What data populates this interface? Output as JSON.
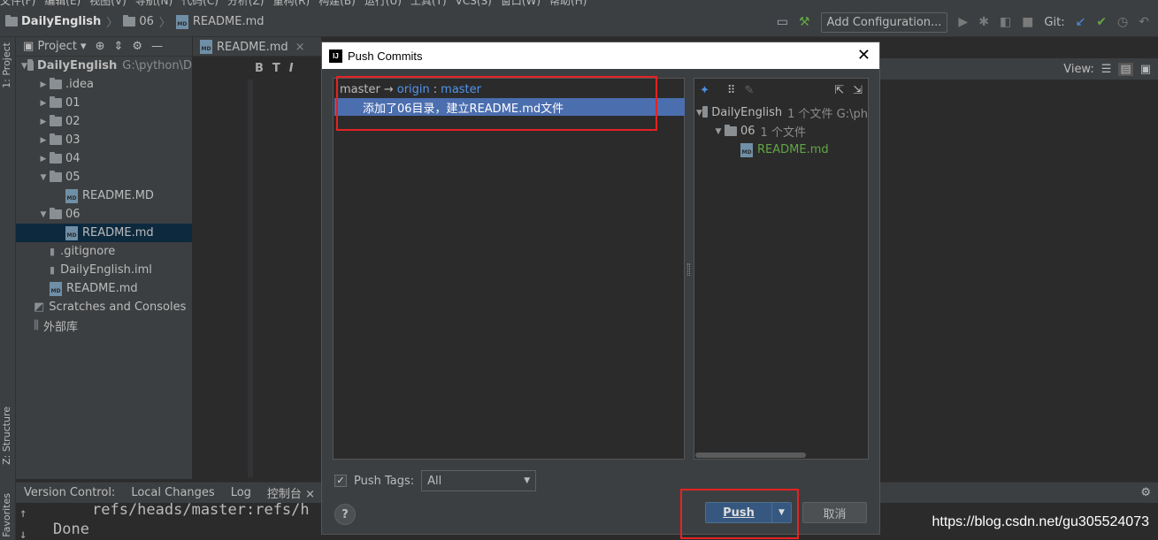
{
  "menu": [
    "文件(F)",
    "编辑(E)",
    "视图(V)",
    "导航(N)",
    "代码(C)",
    "分析(Z)",
    "重构(R)",
    "构建(B)",
    "运行(U)",
    "工具(T)",
    "VCS(S)",
    "窗口(W)",
    "帮助(H)"
  ],
  "breadcrumb": {
    "project": "DailyEnglish",
    "folder": "06",
    "file": "README.md"
  },
  "toolbar": {
    "config_label": "Add Configuration...",
    "git_label": "Git:"
  },
  "left_strip": {
    "project_label": "1: Project",
    "structure_label": "Z: Structure",
    "favorites_label": "Favorites"
  },
  "project_panel": {
    "header": "Project",
    "tree": [
      {
        "label": "DailyEnglish",
        "path": "G:\\python\\D",
        "kind": "folder",
        "level": 0,
        "expanded": true
      },
      {
        "label": ".idea",
        "kind": "folder",
        "level": 1,
        "expanded": false
      },
      {
        "label": "01",
        "kind": "folder",
        "level": 1,
        "expanded": false
      },
      {
        "label": "02",
        "kind": "folder",
        "level": 1,
        "expanded": false
      },
      {
        "label": "03",
        "kind": "folder",
        "level": 1,
        "expanded": false
      },
      {
        "label": "04",
        "kind": "folder",
        "level": 1,
        "expanded": false
      },
      {
        "label": "05",
        "kind": "folder",
        "level": 1,
        "expanded": true
      },
      {
        "label": "README.MD",
        "kind": "md",
        "level": 2
      },
      {
        "label": "06",
        "kind": "folder",
        "level": 1,
        "expanded": true
      },
      {
        "label": "README.md",
        "kind": "md",
        "level": 2,
        "selected": true
      },
      {
        "label": ".gitignore",
        "kind": "file",
        "level": 1
      },
      {
        "label": "DailyEnglish.iml",
        "kind": "file",
        "level": 1
      },
      {
        "label": "README.md",
        "kind": "md",
        "level": 1
      },
      {
        "label": "Scratches and Consoles",
        "kind": "scratch",
        "level": 0
      },
      {
        "label": "外部库",
        "kind": "lib",
        "level": 0
      }
    ]
  },
  "editor": {
    "tab_label": "README.md",
    "view_label": "View:"
  },
  "dialog": {
    "title": "Push Commits",
    "branch": {
      "local": "master",
      "arrow": "→",
      "remote": "origin",
      "colon": ":",
      "remote_branch": "master"
    },
    "commit_message": "添加了06目录，建立README.md文件",
    "changes_tree": [
      {
        "label": "DailyEnglish",
        "detail": "1 个文件  G:\\ph",
        "kind": "folder",
        "level": 0
      },
      {
        "label": "06",
        "detail": "1 个文件",
        "kind": "folder",
        "level": 1
      },
      {
        "label": "README.md",
        "detail": "",
        "kind": "md",
        "level": 2
      }
    ],
    "push_tags_label": "Push Tags:",
    "push_tags_checked": true,
    "push_tags_value": "All",
    "help_label": "?",
    "push_label": "Push",
    "cancel_label": "取消"
  },
  "bottom_tabs": {
    "version_control": "Version Control:",
    "local_changes": "Local Changes",
    "log": "Log",
    "console": "控制台"
  },
  "console_lines": [
    "refs/heads/master:refs/h",
    "Done"
  ],
  "watermark": "https://blog.csdn.net/gu305524073",
  "colors": {
    "accent_blue": "#4b6eaf",
    "annotation_red": "#e52222",
    "link_blue": "#5394ec",
    "vcs_green": "#62a546"
  }
}
